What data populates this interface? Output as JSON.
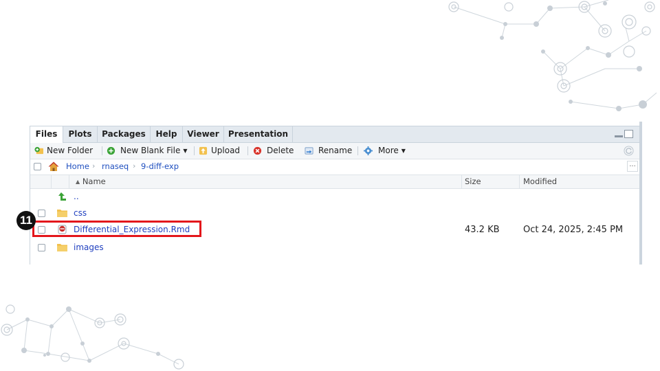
{
  "tabs": [
    "Files",
    "Plots",
    "Packages",
    "Help",
    "Viewer",
    "Presentation"
  ],
  "active_tab": "Files",
  "toolbar": {
    "new_folder": "New Folder",
    "new_blank_file": "New Blank File",
    "upload": "Upload",
    "delete": "Delete",
    "rename": "Rename",
    "more": "More"
  },
  "path": {
    "home": "Home",
    "crumbs": [
      "rnaseq",
      "9-diff-exp"
    ],
    "more": "..."
  },
  "columns": {
    "name": "Name",
    "size": "Size",
    "modified": "Modified"
  },
  "sort_indicator": "▲",
  "parent_dir": "..",
  "files": [
    {
      "name": "css",
      "type": "folder",
      "size": "",
      "modified": ""
    },
    {
      "name": "Differential_Expression.Rmd",
      "type": "rmd",
      "size": "43.2 KB",
      "modified": "Oct 24, 2025, 2:45 PM"
    },
    {
      "name": "images",
      "type": "folder",
      "size": "",
      "modified": ""
    }
  ],
  "step_badge": "11",
  "colors": {
    "highlight": "#e3161b",
    "link": "#1f3fbf",
    "folder": "#f2c14e",
    "up_arrow": "#3aa336"
  }
}
